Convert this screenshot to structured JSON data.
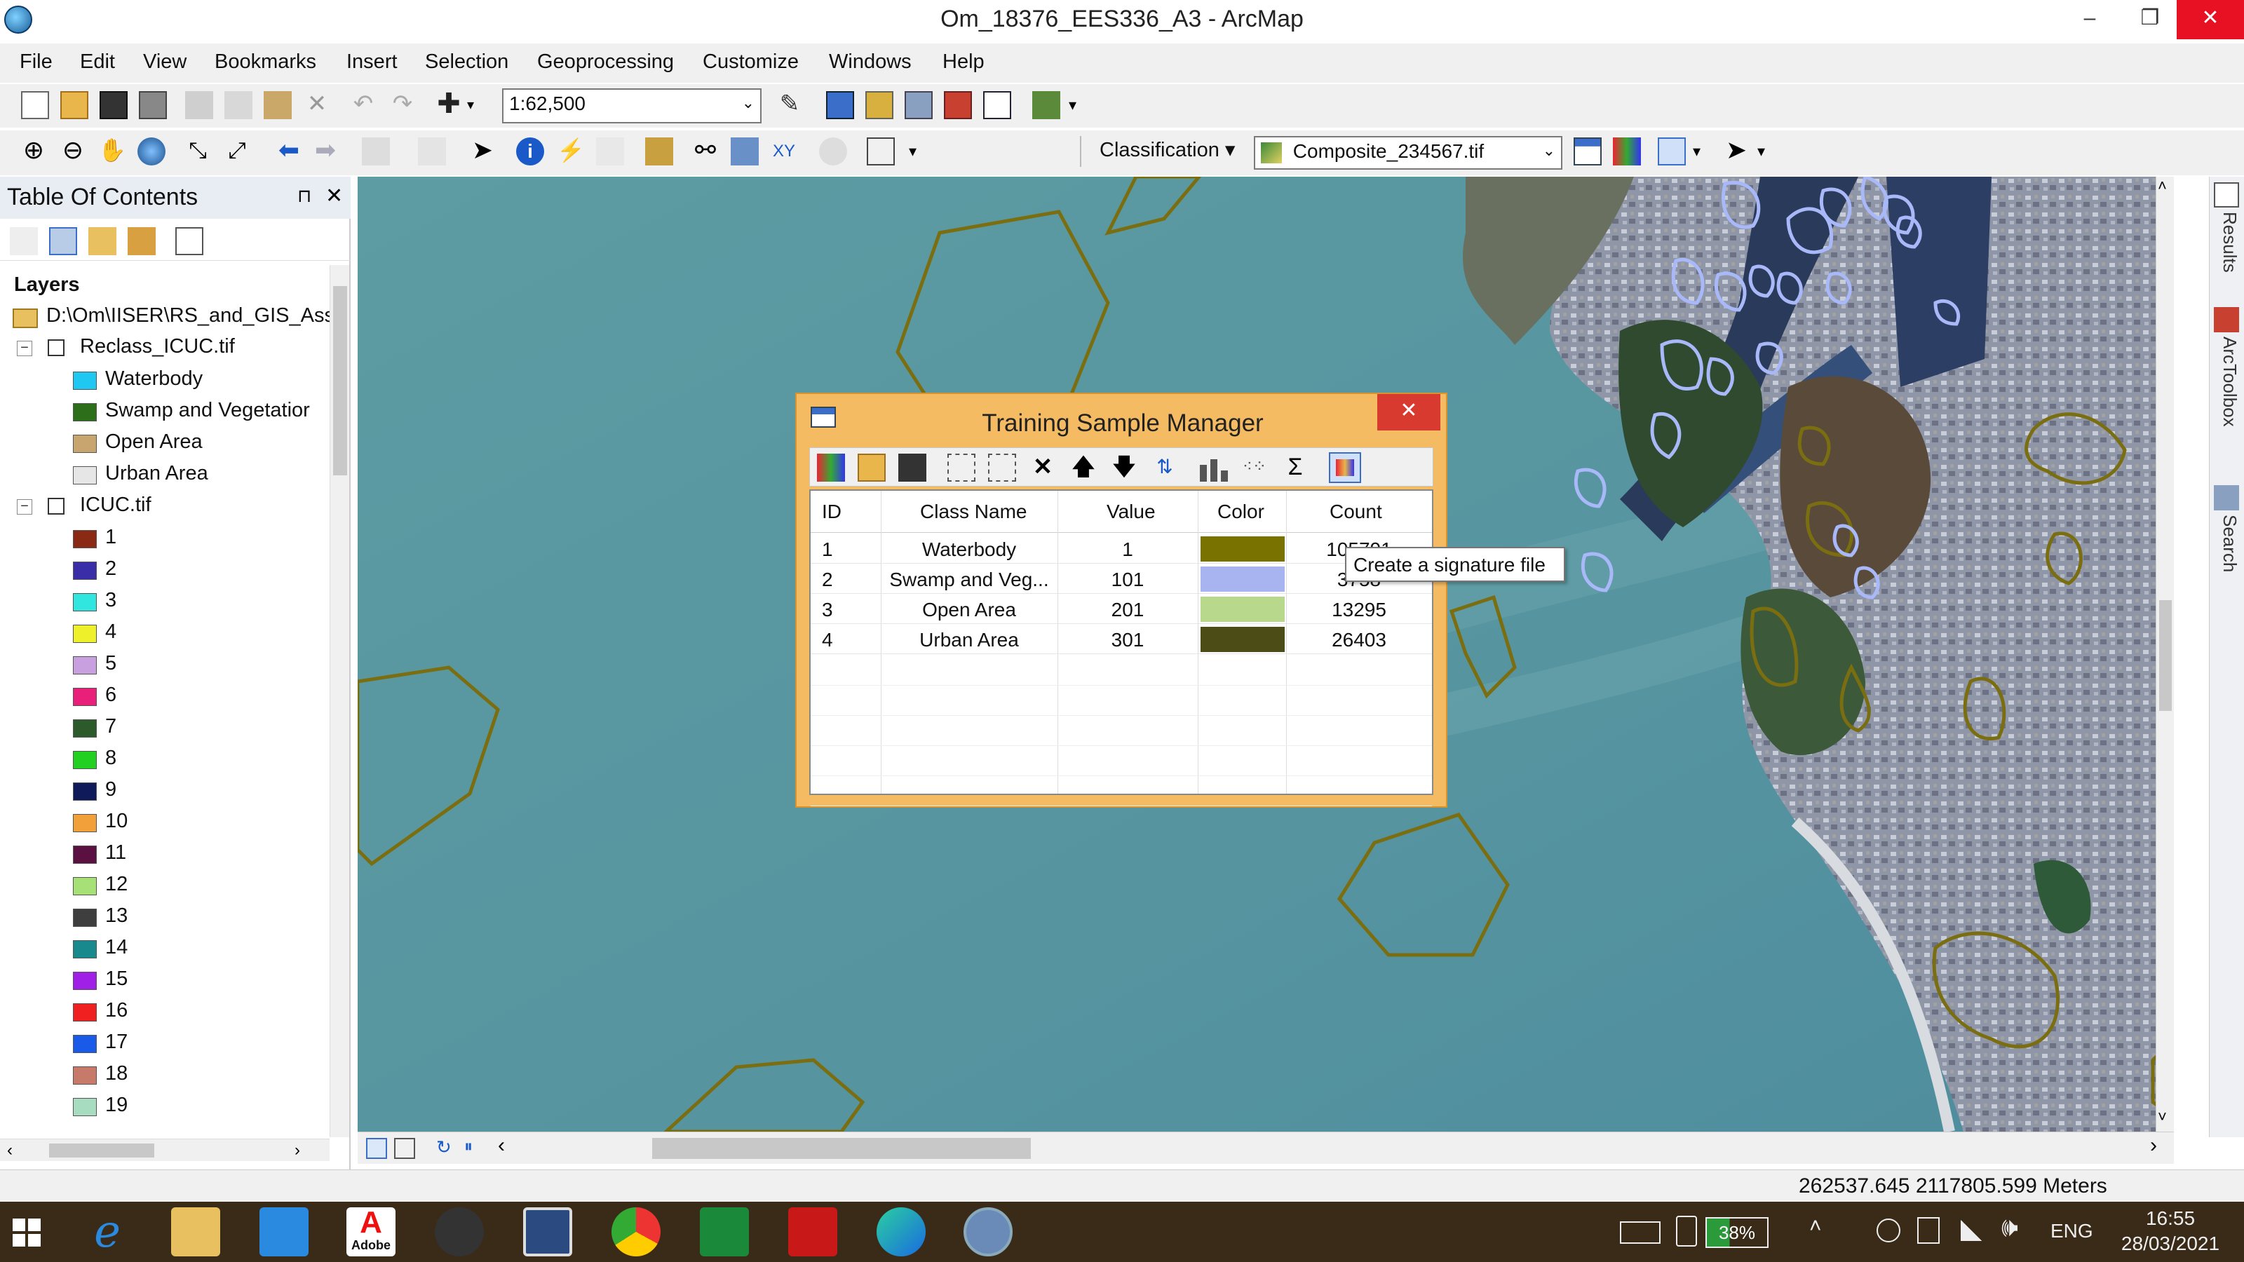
{
  "window": {
    "title": "Om_18376_EES336_A3 - ArcMap",
    "min": "–",
    "max": "❐",
    "close": "✕"
  },
  "menu": [
    "File",
    "Edit",
    "View",
    "Bookmarks",
    "Insert",
    "Selection",
    "Geoprocessing",
    "Customize",
    "Windows",
    "Help"
  ],
  "toolbar": {
    "scale": "1:62,500",
    "classification_label": "Classification ▾",
    "layer": "Composite_234567.tif"
  },
  "toc": {
    "title": "Table Of Contents",
    "pin": "⊓",
    "close": "✕",
    "layers_label": "Layers",
    "path": "D:\\Om\\IISER\\RS_and_GIS_Ass",
    "reclass": {
      "name": "Reclass_ICUC.tif",
      "classes": [
        {
          "label": "Waterbody",
          "color": "#1ec8f0"
        },
        {
          "label": "Swamp and Vegetatior",
          "color": "#2d6e1a"
        },
        {
          "label": "Open Area",
          "color": "#c8a46e"
        },
        {
          "label": "Urban Area",
          "color": "#e6e6e6"
        }
      ]
    },
    "icuc": {
      "name": "ICUC.tif",
      "classes": [
        {
          "label": "1",
          "color": "#8b2a14"
        },
        {
          "label": "2",
          "color": "#3a2ea8"
        },
        {
          "label": "3",
          "color": "#32e6e0"
        },
        {
          "label": "4",
          "color": "#eef02a"
        },
        {
          "label": "5",
          "color": "#c8a0e0"
        },
        {
          "label": "6",
          "color": "#e8207a"
        },
        {
          "label": "7",
          "color": "#2d5a2a"
        },
        {
          "label": "8",
          "color": "#22d022"
        },
        {
          "label": "9",
          "color": "#0e1a5a"
        },
        {
          "label": "10",
          "color": "#f2a03a"
        },
        {
          "label": "11",
          "color": "#5a1040"
        },
        {
          "label": "12",
          "color": "#a8e078"
        },
        {
          "label": "13",
          "color": "#3e3e3e"
        },
        {
          "label": "14",
          "color": "#188a8e"
        },
        {
          "label": "15",
          "color": "#a020e8"
        },
        {
          "label": "16",
          "color": "#f02020"
        },
        {
          "label": "17",
          "color": "#1a5ae8"
        },
        {
          "label": "18",
          "color": "#c87a6a"
        },
        {
          "label": "19",
          "color": "#a8dcc0"
        }
      ]
    }
  },
  "dialog": {
    "title": "Training Sample Manager",
    "close": "✕",
    "columns": [
      "ID",
      "Class Name",
      "Value",
      "Color",
      "Count"
    ],
    "rows": [
      {
        "id": "1",
        "name": "Waterbody",
        "value": "1",
        "color": "#7a7200",
        "count": "105791"
      },
      {
        "id": "2",
        "name": "Swamp and Veg...",
        "value": "101",
        "color": "#a8b4f0",
        "count": "3758"
      },
      {
        "id": "3",
        "name": "Open Area",
        "value": "201",
        "color": "#b8d88c",
        "count": "13295"
      },
      {
        "id": "4",
        "name": "Urban Area",
        "value": "301",
        "color": "#4c4c16",
        "count": "26403"
      }
    ],
    "tooltip": "Create a signature file"
  },
  "dock": {
    "results": "Results",
    "toolbox": "ArcToolbox",
    "search": "Search"
  },
  "status": {
    "coords": "262537.645  2117805.599 Meters"
  },
  "tray": {
    "battery": "38%",
    "lang": "ENG",
    "time": "16:55",
    "date": "28/03/2021"
  },
  "taskbar": {
    "adobe_label": "Adobe"
  },
  "colors": {
    "accent": "#f4bb62",
    "polygon": "#7a6e10",
    "swamp_polygon": "#a8b8f8"
  }
}
